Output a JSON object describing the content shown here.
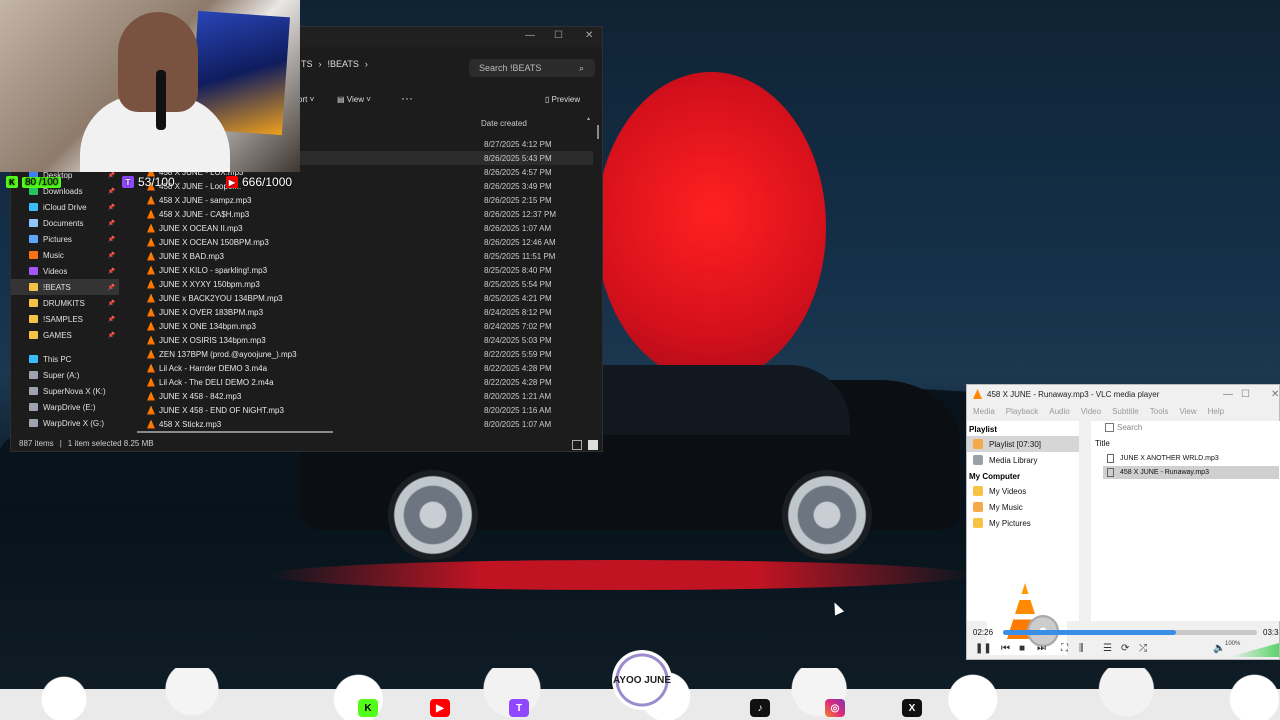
{
  "stream": {
    "kick": "80 /100",
    "twitch": "53/100",
    "youtube": "666/1000"
  },
  "explorer": {
    "breadcrumb": [
      "TS",
      "!BEATS"
    ],
    "search_placeholder": "Search !BEATS",
    "toolbar": {
      "sort": "ort",
      "view": "View",
      "more": "···",
      "preview": "Preview"
    },
    "column_date": "Date created",
    "sidebar": [
      {
        "label": "Desktop",
        "color": "#3b82f6",
        "pin": true
      },
      {
        "label": "Downloads",
        "color": "#22c55e",
        "pin": true
      },
      {
        "label": "iCloud Drive",
        "color": "#38bdf8",
        "pin": true
      },
      {
        "label": "Documents",
        "color": "#93c5fd",
        "pin": true
      },
      {
        "label": "Pictures",
        "color": "#60a5fa",
        "pin": true
      },
      {
        "label": "Music",
        "color": "#f97316",
        "pin": true
      },
      {
        "label": "Videos",
        "color": "#a855f7",
        "pin": true
      },
      {
        "label": "!BEATS",
        "color": "#f6c343",
        "pin": true,
        "active": true
      },
      {
        "label": "DRUMKITS",
        "color": "#f6c343",
        "pin": true
      },
      {
        "label": "!SAMPLES",
        "color": "#f6c343",
        "pin": true
      },
      {
        "label": "GAMES",
        "color": "#f6c343",
        "pin": true
      }
    ],
    "drives": [
      {
        "label": "This PC",
        "color": "#38bdf8"
      },
      {
        "label": "Super (A:)",
        "color": "#9ca3af"
      },
      {
        "label": "SuperNova X (K:)",
        "color": "#9ca3af"
      },
      {
        "label": "WarpDrive (E:)",
        "color": "#9ca3af"
      },
      {
        "label": "WarpDrive X (G:)",
        "color": "#9ca3af"
      }
    ],
    "files": [
      {
        "name": "",
        "date": "8/27/2025 4:12 PM"
      },
      {
        "name": "",
        "date": "8/26/2025 5:43 PM",
        "selected": true
      },
      {
        "name": "458 X JUNE - LUX.mp3",
        "date": "8/26/2025 4:57 PM"
      },
      {
        "name": "458 X JUNE - Looper...",
        "date": "8/26/2025 3:49 PM"
      },
      {
        "name": "458 X JUNE - sampz.mp3",
        "date": "8/26/2025 2:15 PM"
      },
      {
        "name": "458 X JUNE - CA$H.mp3",
        "date": "8/26/2025 12:37 PM"
      },
      {
        "name": "JUNE X OCEAN II.mp3",
        "date": "8/26/2025 1:07 AM"
      },
      {
        "name": "JUNE X OCEAN 150BPM.mp3",
        "date": "8/26/2025 12:46 AM"
      },
      {
        "name": "JUNE X BAD.mp3",
        "date": "8/25/2025 11:51 PM"
      },
      {
        "name": "JUNE X KILO - sparkling!.mp3",
        "date": "8/25/2025 8:40 PM"
      },
      {
        "name": "JUNE X XYXY 150bpm.mp3",
        "date": "8/25/2025 5:54 PM"
      },
      {
        "name": "JUNE x BACK2YOU 134BPM.mp3",
        "date": "8/25/2025 4:21 PM"
      },
      {
        "name": "JUNE X OVER 183BPM.mp3",
        "date": "8/24/2025 8:12 PM"
      },
      {
        "name": "JUNE X ONE 134bpm.mp3",
        "date": "8/24/2025 7:02 PM"
      },
      {
        "name": "JUNE X OSIRIS 134bpm.mp3",
        "date": "8/24/2025 5:03 PM"
      },
      {
        "name": "ZEN 137BPM (prod.@ayoojune_).mp3",
        "date": "8/22/2025 5:59 PM"
      },
      {
        "name": "Lil Ack - Harrder DEMO 3.m4a",
        "date": "8/22/2025 4:28 PM"
      },
      {
        "name": "Lil Ack - The DELI DEMO 2.m4a",
        "date": "8/22/2025 4:28 PM"
      },
      {
        "name": "JUNE X 458 - 842.mp3",
        "date": "8/20/2025 1:21 AM"
      },
      {
        "name": "JUNE X 458 - END OF NiGHT.mp3",
        "date": "8/20/2025 1:16 AM"
      },
      {
        "name": "458 X Stickz.mp3",
        "date": "8/20/2025 1:07 AM"
      }
    ],
    "status_count": "887 items",
    "status_selected": "1 item selected  8.25 MB"
  },
  "vlc": {
    "title": "458 X JUNE - Runaway.mp3 - VLC media player",
    "menu": [
      "Media",
      "Playback",
      "Audio",
      "Video",
      "Subtitle",
      "Tools",
      "View",
      "Help"
    ],
    "section_playlist": "Playlist",
    "playlist_item": "Playlist [07:30]",
    "media_library": "Media Library",
    "section_computer": "My Computer",
    "my_videos": "My Videos",
    "my_music": "My Music",
    "my_pictures": "My Pictures",
    "search_placeholder": "Search",
    "col_title": "Title",
    "tracks": [
      "JUNE X ANOTHER WRLD.mp3",
      "458 X JUNE - Runaway.mp3"
    ],
    "time_current": "02:26",
    "time_total": "03:3",
    "progress": 0.68,
    "volume": "100%"
  },
  "overlay": {
    "logo_text": "AYOO JUNE",
    "socials": [
      "K",
      "▶",
      "T",
      "♪",
      "◎",
      "X"
    ]
  }
}
